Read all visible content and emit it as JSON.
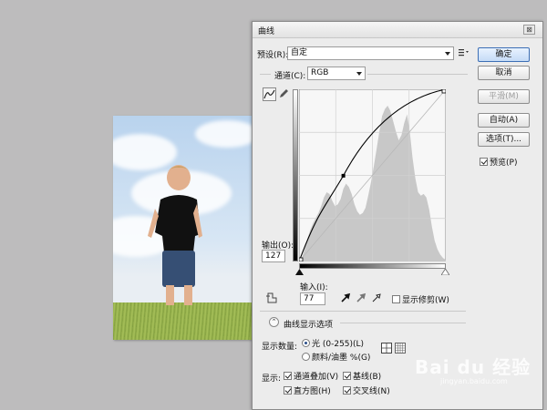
{
  "window": {
    "title": "曲线",
    "close_glyph": "⊠"
  },
  "preset": {
    "label": "预设(R):",
    "value": "自定",
    "menu_icon": "preset-options-icon"
  },
  "channel": {
    "label": "通道(C):",
    "value": "RGB"
  },
  "buttons": {
    "ok": "确定",
    "cancel": "取消",
    "smooth": "平滑(M)",
    "auto": "自动(A)",
    "options": "选项(T)..."
  },
  "preview": {
    "label": "预览(P)",
    "checked": true
  },
  "curve": {
    "output_label": "输出(O):",
    "output_value": "127",
    "input_label": "输入(I):",
    "input_value": "77",
    "control_point": [
      77,
      127
    ],
    "show_clipping_label": "显示修剪(W)"
  },
  "display_options": {
    "header": "曲线显示选项",
    "amount_label": "显示数量:",
    "light_option": "光 (0-255)(L)",
    "pigment_option": "颜料/油墨 %(G)",
    "show_label": "显示:",
    "channel_overlay": "通道叠加(V)",
    "baseline": "基线(B)",
    "histogram": "直方图(H)",
    "intersection": "交叉线(N)"
  },
  "colors": {
    "ok_border": "#3d6fb5",
    "curve": "#000000",
    "histogram": "#c8c8c8"
  },
  "watermark": {
    "brand": "Bai du 经验",
    "url": "jingyan.baidu.com"
  }
}
